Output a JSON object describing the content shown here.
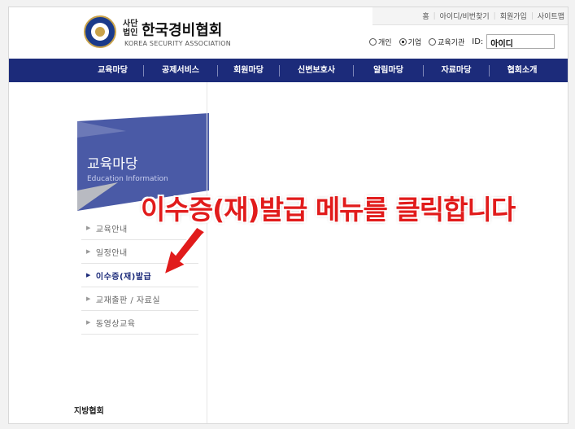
{
  "header": {
    "util_links": [
      "홈",
      "아이디/비번찾기",
      "회원가입",
      "사이트맵"
    ],
    "logo": {
      "small_top": "사단",
      "small_bottom": "법인",
      "title": "한국경비협회",
      "subtitle": "KOREA SECURITY ASSOCIATION"
    },
    "login": {
      "options": [
        "개인",
        "기업",
        "교육기관"
      ],
      "selected": "기업",
      "id_label": "ID:",
      "id_value": "아이디"
    }
  },
  "nav": {
    "items": [
      "교육마당",
      "공제서비스",
      "회원마당",
      "신변보호사",
      "알림마당",
      "자료마당",
      "협회소개"
    ]
  },
  "sidebar": {
    "title": "교육마당",
    "subtitle": "Education Information",
    "items": [
      {
        "label": "교육안내",
        "active": false
      },
      {
        "label": "일정안내",
        "active": false
      },
      {
        "label": "이수증(재)발급",
        "active": true
      },
      {
        "label": "교재출판 / 자료실",
        "active": false
      },
      {
        "label": "동영상교육",
        "active": false
      }
    ],
    "region_title": "지방협회"
  },
  "annotation": {
    "text": "이수증(재)발급 메뉴를 클릭합니다"
  },
  "colors": {
    "nav_bg": "#1c2b7a",
    "banner_blue": "#4a5aa6",
    "annotation_red": "#e11b1b"
  }
}
